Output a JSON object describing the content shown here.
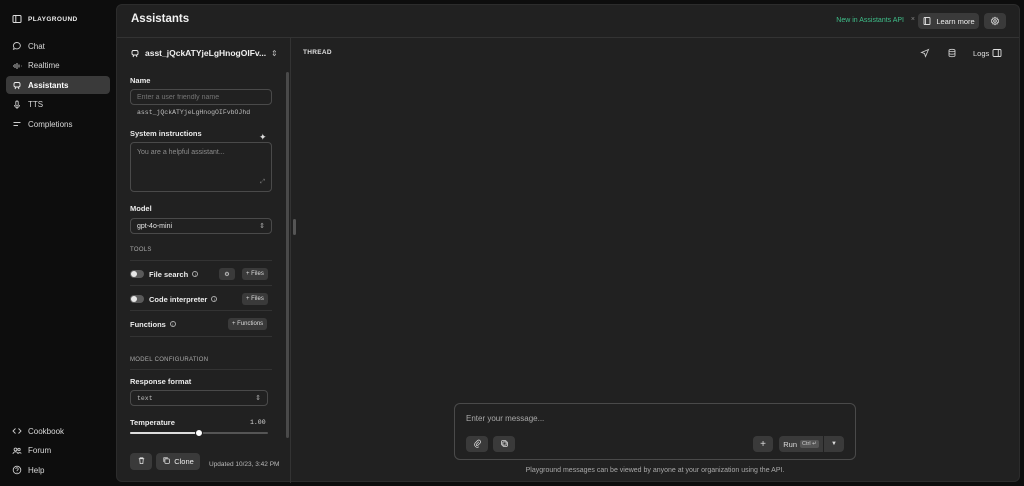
{
  "brand": {
    "name": "PLAYGROUND"
  },
  "sidebar": {
    "items": [
      {
        "label": "Chat",
        "icon": "chat-bubble-icon"
      },
      {
        "label": "Realtime",
        "icon": "audio-wave-icon"
      },
      {
        "label": "Assistants",
        "icon": "robot-icon",
        "active": true
      },
      {
        "label": "TTS",
        "icon": "microphone-icon"
      },
      {
        "label": "Completions",
        "icon": "lines-icon"
      }
    ],
    "bottom": [
      {
        "label": "Cookbook",
        "icon": "code-icon"
      },
      {
        "label": "Forum",
        "icon": "people-icon"
      },
      {
        "label": "Help",
        "icon": "help-circle-icon"
      }
    ]
  },
  "header": {
    "title": "Assistants",
    "new_in": "New in Assistants API",
    "new_close": "×",
    "learn_more": "Learn more"
  },
  "assistant": {
    "name_display": "asst_jQckATYjeLgHnogOIFv...",
    "name_label": "Name",
    "name_placeholder": "Enter a user friendly name",
    "id": "asst_jQckATYjeLgHnogOIFvbOJhd",
    "instructions_label": "System instructions",
    "instructions_placeholder": "You are a helpful assistant...",
    "model_label": "Model",
    "model_value": "gpt-4o-mini",
    "tools_label": "TOOLS",
    "tools": {
      "file_search": "File search",
      "code_interpreter": "Code interpreter",
      "functions": "Functions",
      "files_label": "+ Files",
      "functions_chip": "+ Functions"
    },
    "model_config_label": "MODEL CONFIGURATION",
    "response_format_label": "Response format",
    "response_format_value": "text",
    "temperature_label": "Temperature",
    "temperature_value": "1.00",
    "temperature_fraction": 0.5,
    "clone_label": "Clone",
    "updated": "Updated 10/23, 3:42 PM"
  },
  "thread": {
    "label": "THREAD",
    "logs_label": "Logs",
    "composer_placeholder": "Enter your message...",
    "run_label": "Run",
    "run_kbd": "Ctrl ↵",
    "add_label": "+",
    "disclaimer": "Playground messages can be viewed by anyone at your organization using the API."
  },
  "colors": {
    "accent_green": "#3fbf8a",
    "panel_bg": "#212121",
    "page_bg": "#0d0d0d"
  }
}
